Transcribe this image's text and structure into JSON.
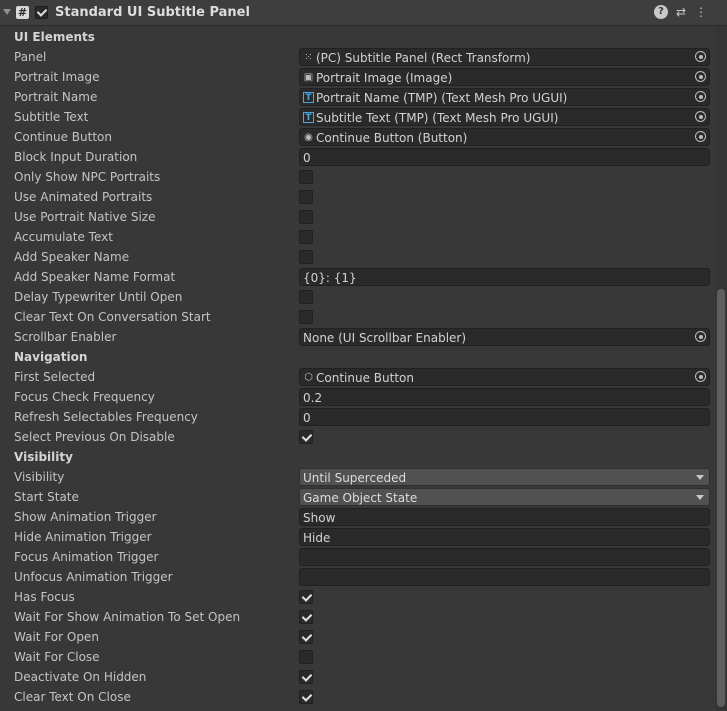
{
  "header": {
    "title": "Standard UI Subtitle Panel",
    "script_glyph": "#",
    "help_glyph": "?",
    "presets_glyph": "⇄",
    "menu_glyph": "⋮"
  },
  "rows": [
    {
      "kind": "section",
      "label": "UI Elements"
    },
    {
      "kind": "object",
      "label": "Panel",
      "value": "(PC) Subtitle Panel (Rect Transform)",
      "icon": "rect-transform-icon",
      "glyph": "⁙"
    },
    {
      "kind": "object",
      "label": "Portrait Image",
      "value": "Portrait Image (Image)",
      "icon": "image-icon",
      "glyph": "▣"
    },
    {
      "kind": "object",
      "label": "Portrait Name",
      "value": "Portrait Name (TMP) (Text Mesh Pro UGUI)",
      "icon": "tmp-text-icon",
      "glyph": "T"
    },
    {
      "kind": "object",
      "label": "Subtitle Text",
      "value": "Subtitle Text (TMP) (Text Mesh Pro UGUI)",
      "icon": "tmp-text-icon",
      "glyph": "T"
    },
    {
      "kind": "object",
      "label": "Continue Button",
      "value": "Continue Button (Button)",
      "icon": "button-icon",
      "glyph": "◉"
    },
    {
      "kind": "text",
      "label": "Block Input Duration",
      "value": "0"
    },
    {
      "kind": "check",
      "label": "Only Show NPC Portraits",
      "checked": false
    },
    {
      "kind": "check",
      "label": "Use Animated Portraits",
      "checked": false
    },
    {
      "kind": "check",
      "label": "Use Portrait Native Size",
      "checked": false
    },
    {
      "kind": "check",
      "label": "Accumulate Text",
      "checked": false
    },
    {
      "kind": "check",
      "label": "Add Speaker Name",
      "checked": false
    },
    {
      "kind": "text",
      "label": "Add Speaker Name Format",
      "value": "{0}: {1}"
    },
    {
      "kind": "check",
      "label": "Delay Typewriter Until Open",
      "checked": false
    },
    {
      "kind": "check",
      "label": "Clear Text On Conversation Start",
      "checked": false
    },
    {
      "kind": "object-none",
      "label": "Scrollbar Enabler",
      "value": "None (UI Scrollbar Enabler)"
    },
    {
      "kind": "section",
      "label": "Navigation"
    },
    {
      "kind": "object",
      "label": "First Selected",
      "value": "Continue Button",
      "icon": "gameobject-icon",
      "glyph": "⬡"
    },
    {
      "kind": "text",
      "label": "Focus Check Frequency",
      "value": "0.2"
    },
    {
      "kind": "text",
      "label": "Refresh Selectables Frequency",
      "value": "0"
    },
    {
      "kind": "check",
      "label": "Select Previous On Disable",
      "checked": true
    },
    {
      "kind": "section",
      "label": "Visibility"
    },
    {
      "kind": "dropdown",
      "label": "Visibility",
      "value": "Until Superceded"
    },
    {
      "kind": "dropdown",
      "label": "Start State",
      "value": "Game Object State"
    },
    {
      "kind": "text",
      "label": "Show Animation Trigger",
      "value": "Show"
    },
    {
      "kind": "text",
      "label": "Hide Animation Trigger",
      "value": "Hide"
    },
    {
      "kind": "text",
      "label": "Focus Animation Trigger",
      "value": ""
    },
    {
      "kind": "text",
      "label": "Unfocus Animation Trigger",
      "value": ""
    },
    {
      "kind": "check",
      "label": "Has Focus",
      "checked": true
    },
    {
      "kind": "check",
      "label": "Wait For Show Animation To Set Open",
      "checked": true
    },
    {
      "kind": "check",
      "label": "Wait For Open",
      "checked": true
    },
    {
      "kind": "check",
      "label": "Wait For Close",
      "checked": false
    },
    {
      "kind": "check",
      "label": "Deactivate On Hidden",
      "checked": true
    },
    {
      "kind": "check",
      "label": "Clear Text On Close",
      "checked": true
    }
  ]
}
